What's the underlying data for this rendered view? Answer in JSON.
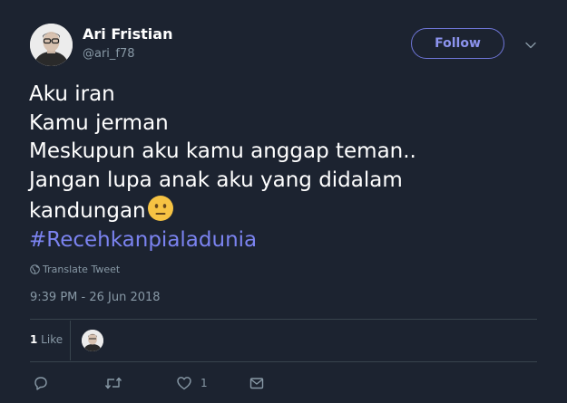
{
  "user": {
    "display_name": "Ari Fristian",
    "handle": "@ari_f78",
    "avatar": "avatar-photo"
  },
  "follow": {
    "label": "Follow"
  },
  "menu": {
    "icon": "chevron-down-icon"
  },
  "tweet": {
    "lines": [
      "Aku iran",
      "Kamu jerman",
      "Meskupun aku kamu anggap teman..",
      "Jangan lupa anak aku yang didalam",
      "kandungan"
    ],
    "emoji": "neutral-face-emoji",
    "hashtag": "#Recehkanpialadunia"
  },
  "translate": {
    "label": "Translate Tweet",
    "icon": "globe-icon"
  },
  "timestamp": "9:39 PM - 26 Jun 2018",
  "stats": {
    "likes_count": "1",
    "likes_label": " Like"
  },
  "actions": {
    "reply": {
      "icon": "reply-icon"
    },
    "retweet": {
      "icon": "retweet-icon"
    },
    "like": {
      "icon": "heart-icon",
      "count": "1"
    },
    "dm": {
      "icon": "envelope-icon"
    }
  },
  "colors": {
    "background": "#1c2330",
    "accent": "#7b83f0",
    "muted": "#8899a6",
    "divider": "#38444d"
  }
}
